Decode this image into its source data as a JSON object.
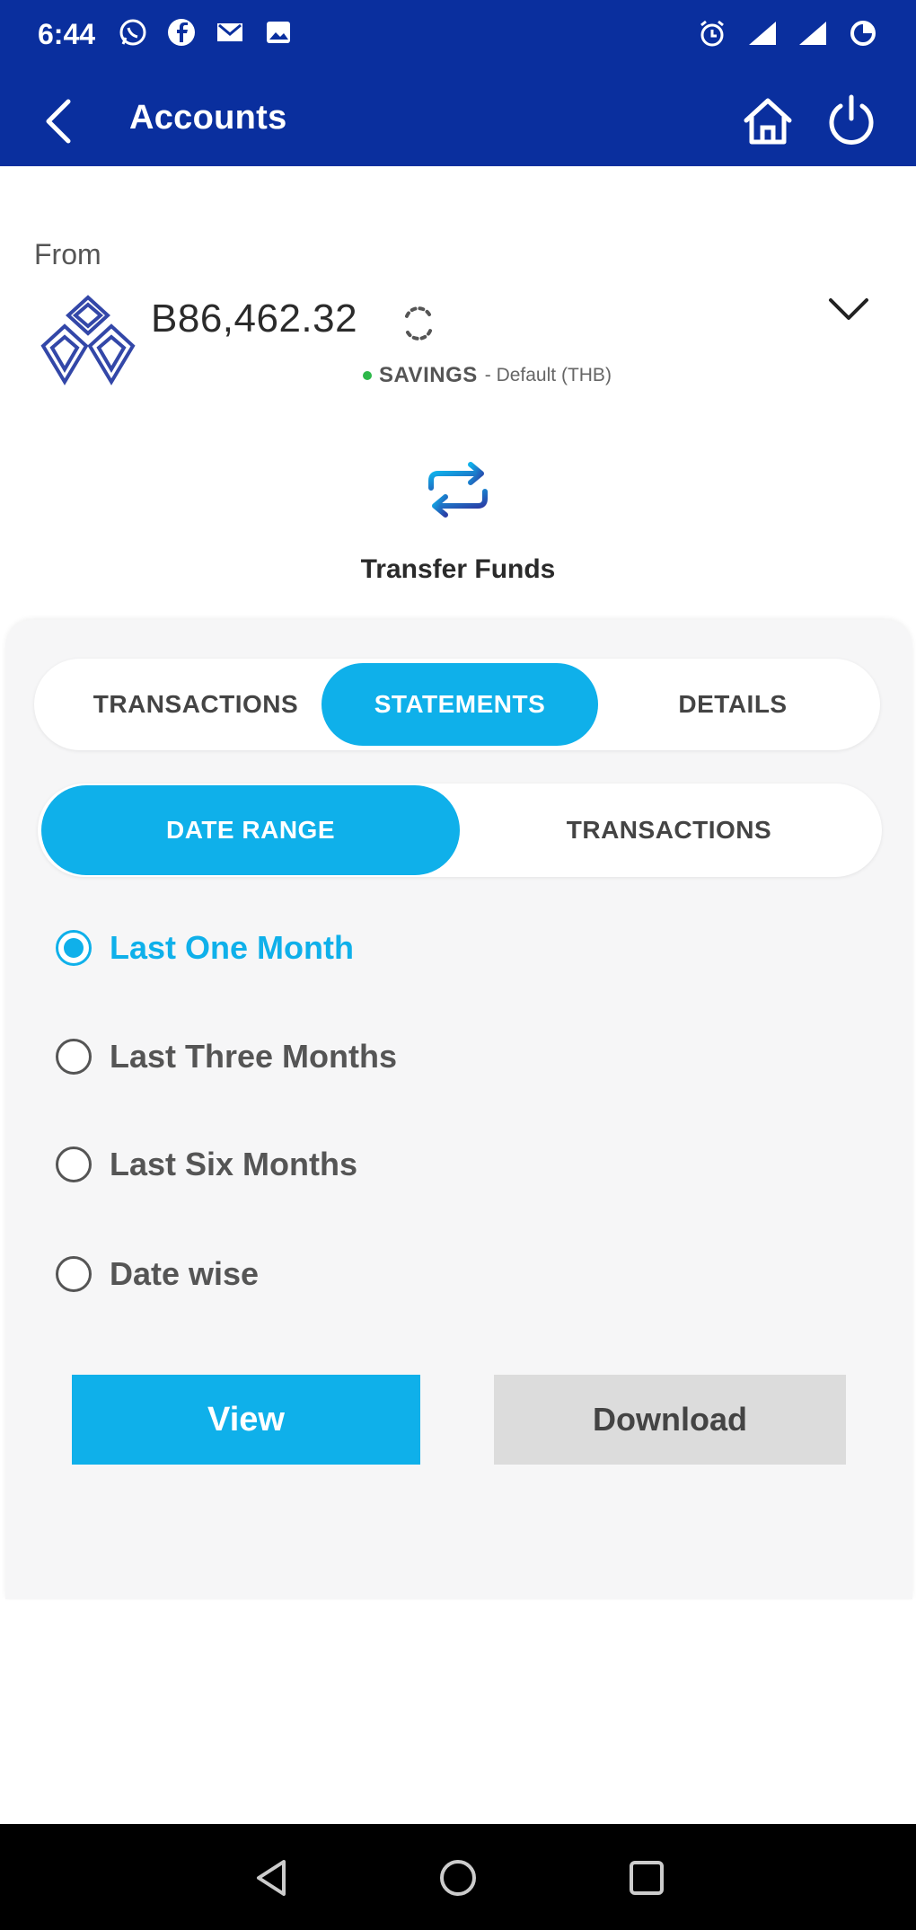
{
  "status_bar": {
    "time": "6:44"
  },
  "app_bar": {
    "title": "Accounts"
  },
  "account": {
    "from_label": "From",
    "balance": "B86,462.32",
    "type": "SAVINGS",
    "subtitle": "- Default (THB)"
  },
  "transfer": {
    "label": "Transfer Funds"
  },
  "tabs": [
    {
      "label": "TRANSACTIONS",
      "active": false
    },
    {
      "label": "STATEMENTS",
      "active": true
    },
    {
      "label": "DETAILS",
      "active": false
    }
  ],
  "sub_tabs": [
    {
      "label": "DATE RANGE",
      "active": true
    },
    {
      "label": "TRANSACTIONS",
      "active": false
    }
  ],
  "date_options": [
    {
      "label": "Last One Month",
      "selected": true
    },
    {
      "label": "Last Three Months",
      "selected": false
    },
    {
      "label": "Last Six Months",
      "selected": false
    },
    {
      "label": "Date wise",
      "selected": false
    }
  ],
  "actions": {
    "view_label": "View",
    "download_label": "Download"
  },
  "colors": {
    "primary": "#0a2f9e",
    "accent": "#0fb0ea",
    "status_green": "#2db84a"
  }
}
